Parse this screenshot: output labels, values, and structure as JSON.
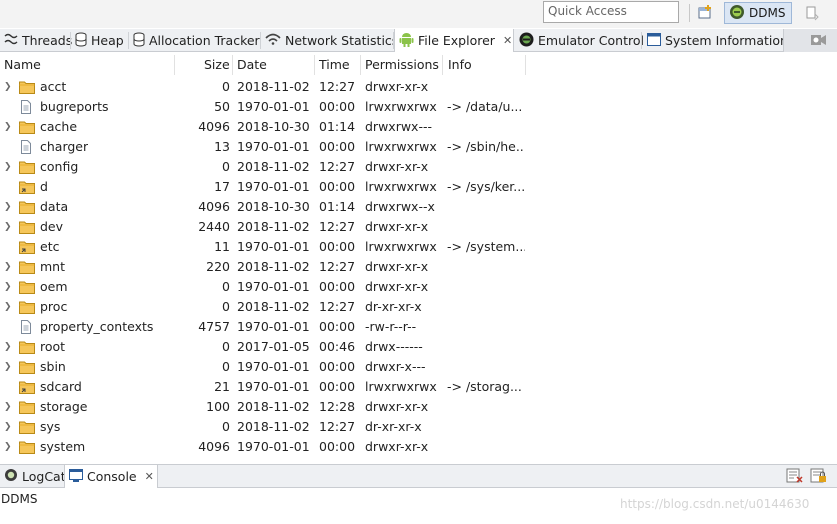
{
  "toolbar": {
    "quick_access_placeholder": "Quick Access",
    "perspective_label": "DDMS"
  },
  "tabs": [
    {
      "label": "Threads",
      "icon": "threads-icon"
    },
    {
      "label": "Heap",
      "icon": "heap-icon"
    },
    {
      "label": "Allocation Tracker",
      "icon": "allocation-icon"
    },
    {
      "label": "Network Statistics",
      "icon": "network-icon"
    },
    {
      "label": "File Explorer",
      "icon": "android-icon",
      "active": true
    },
    {
      "label": "Emulator Control",
      "icon": "emulator-icon"
    },
    {
      "label": "System Information",
      "icon": "system-info-icon"
    }
  ],
  "table": {
    "columns": [
      "Name",
      "Size",
      "Date",
      "Time",
      "Permissions",
      "Info"
    ],
    "rows": [
      {
        "name": "acct",
        "type": "folder",
        "size": "0",
        "date": "2018-11-02",
        "time": "12:27",
        "perm": "drwxr-xr-x",
        "info": ""
      },
      {
        "name": "bugreports",
        "type": "file",
        "size": "50",
        "date": "1970-01-01",
        "time": "00:00",
        "perm": "lrwxrwxrwx",
        "info": "-> /data/u..."
      },
      {
        "name": "cache",
        "type": "folder",
        "size": "4096",
        "date": "2018-10-30",
        "time": "01:14",
        "perm": "drwxrwx---",
        "info": ""
      },
      {
        "name": "charger",
        "type": "file",
        "size": "13",
        "date": "1970-01-01",
        "time": "00:00",
        "perm": "lrwxrwxrwx",
        "info": "-> /sbin/he..."
      },
      {
        "name": "config",
        "type": "folder",
        "size": "0",
        "date": "2018-11-02",
        "time": "12:27",
        "perm": "drwxr-xr-x",
        "info": ""
      },
      {
        "name": "d",
        "type": "link-folder",
        "size": "17",
        "date": "1970-01-01",
        "time": "00:00",
        "perm": "lrwxrwxrwx",
        "info": "-> /sys/ker..."
      },
      {
        "name": "data",
        "type": "folder",
        "size": "4096",
        "date": "2018-10-30",
        "time": "01:14",
        "perm": "drwxrwx--x",
        "info": ""
      },
      {
        "name": "dev",
        "type": "folder",
        "size": "2440",
        "date": "2018-11-02",
        "time": "12:27",
        "perm": "drwxr-xr-x",
        "info": ""
      },
      {
        "name": "etc",
        "type": "link-folder",
        "size": "11",
        "date": "1970-01-01",
        "time": "00:00",
        "perm": "lrwxrwxrwx",
        "info": "-> /system..."
      },
      {
        "name": "mnt",
        "type": "folder",
        "size": "220",
        "date": "2018-11-02",
        "time": "12:27",
        "perm": "drwxr-xr-x",
        "info": ""
      },
      {
        "name": "oem",
        "type": "folder",
        "size": "0",
        "date": "1970-01-01",
        "time": "00:00",
        "perm": "drwxr-xr-x",
        "info": ""
      },
      {
        "name": "proc",
        "type": "folder",
        "size": "0",
        "date": "2018-11-02",
        "time": "12:27",
        "perm": "dr-xr-xr-x",
        "info": ""
      },
      {
        "name": "property_contexts",
        "type": "file",
        "size": "4757",
        "date": "1970-01-01",
        "time": "00:00",
        "perm": "-rw-r--r--",
        "info": ""
      },
      {
        "name": "root",
        "type": "folder",
        "size": "0",
        "date": "2017-01-05",
        "time": "00:46",
        "perm": "drwx------",
        "info": ""
      },
      {
        "name": "sbin",
        "type": "folder",
        "size": "0",
        "date": "1970-01-01",
        "time": "00:00",
        "perm": "drwxr-x---",
        "info": ""
      },
      {
        "name": "sdcard",
        "type": "link-folder",
        "size": "21",
        "date": "1970-01-01",
        "time": "00:00",
        "perm": "lrwxrwxrwx",
        "info": "-> /storag..."
      },
      {
        "name": "storage",
        "type": "folder",
        "size": "100",
        "date": "2018-11-02",
        "time": "12:28",
        "perm": "drwxr-xr-x",
        "info": ""
      },
      {
        "name": "sys",
        "type": "folder",
        "size": "0",
        "date": "2018-11-02",
        "time": "12:27",
        "perm": "dr-xr-xr-x",
        "info": ""
      },
      {
        "name": "system",
        "type": "folder",
        "size": "4096",
        "date": "1970-01-01",
        "time": "00:00",
        "perm": "drwxr-xr-x",
        "info": ""
      }
    ]
  },
  "bottom_tabs": [
    {
      "label": "LogCat",
      "icon": "logcat-icon"
    },
    {
      "label": "Console",
      "icon": "console-icon",
      "active": true
    }
  ],
  "console_title": "DDMS",
  "watermark": "https://blog.csdn.net/u0144630"
}
